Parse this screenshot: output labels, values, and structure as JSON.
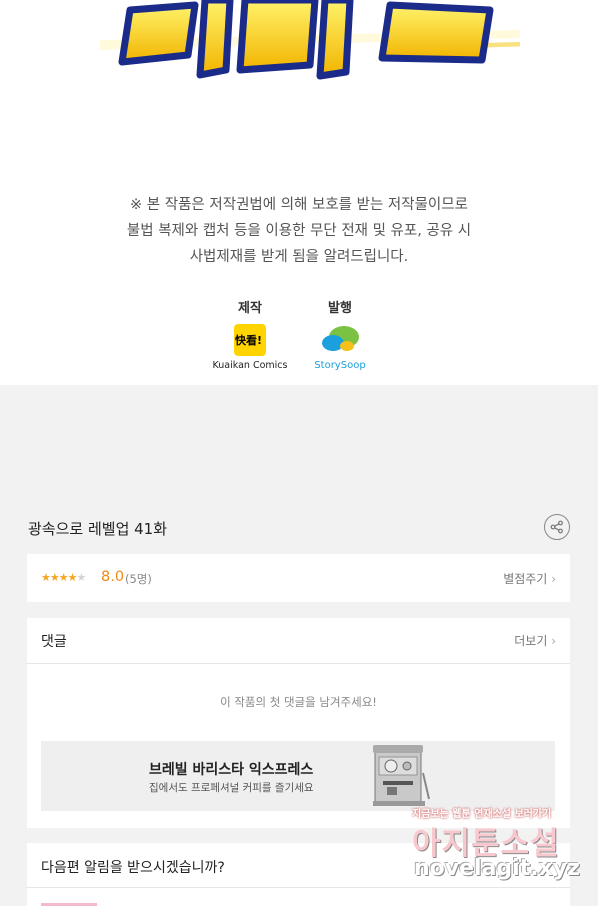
{
  "copyright": {
    "lines": [
      "※ 본 작품은 저작권법에 의해 보호를 받는 저작물이므로",
      "불법 복제와 캡처 등을  이용한 무단 전재 및 유포, 공유 시",
      "사법제재를  받게 됨을 알려드립니다."
    ]
  },
  "credits": {
    "production": {
      "role": "제작",
      "logo_text": "快看!",
      "name": "Kuaikan Comics"
    },
    "publisher": {
      "role": "발행",
      "name": "StorySoop"
    }
  },
  "episode": {
    "title": "광속으로 레벨업 41화",
    "share_icon": "share-icon"
  },
  "rating": {
    "stars_filled": 4,
    "stars_total": 5,
    "score": "8.0",
    "count": "(5명)",
    "rate_label": "별점주기",
    "accent": "#f08a14"
  },
  "comments": {
    "title": "댓글",
    "more_label": "더보기",
    "empty_text": "이 작품의 첫 댓글을 남겨주세요!"
  },
  "ad": {
    "title": "브레빌 바리스타 익스프레스",
    "subtitle": "집에서도 프로페셔널 커피를 즐기세요"
  },
  "notify": {
    "title": "다음편 알림을 받으시겠습니까?"
  },
  "watermark": {
    "small": "지금보는 웹툰 연재소설 보러가기",
    "big": "아지툰소설",
    "url": "novelagit.xyz"
  }
}
